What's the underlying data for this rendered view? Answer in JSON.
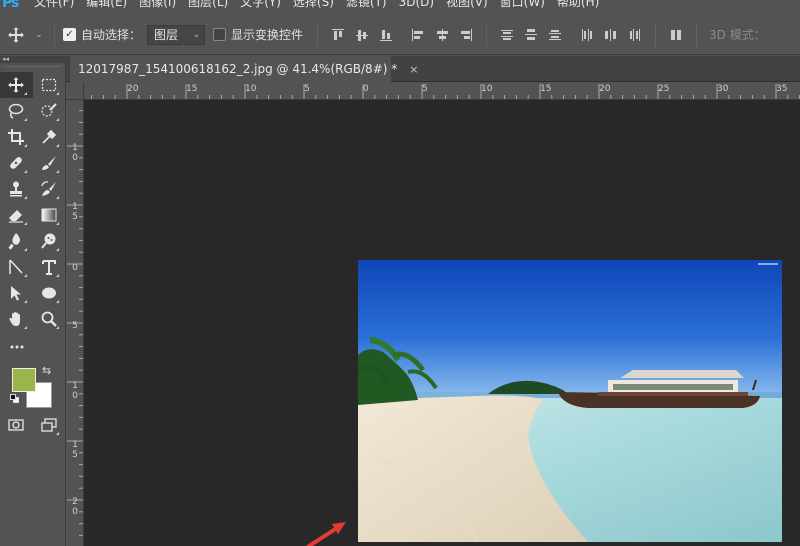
{
  "app": {
    "logo": "Ps"
  },
  "menu": [
    "文件(F)",
    "编辑(E)",
    "图像(I)",
    "图层(L)",
    "文字(Y)",
    "选择(S)",
    "滤镜(T)",
    "3D(D)",
    "视图(V)",
    "窗口(W)",
    "帮助(H)"
  ],
  "options": {
    "auto_select_label": "自动选择：",
    "auto_select_checked": true,
    "layer_select_value": "图层",
    "show_transform_label": "显示变换控件",
    "mode_3d_label": "3D 模式："
  },
  "document": {
    "tab_title": "12017987_154100618162_2.jpg @ 41.4%(RGB/8#) *",
    "close_glyph": "×"
  },
  "ruler": {
    "h_labels": [
      "20",
      "15",
      "10",
      "5",
      "0",
      "5",
      "10",
      "15",
      "20",
      "25",
      "30",
      "35"
    ],
    "v_labels": [
      "1",
      "0",
      "1",
      "5",
      "0",
      "5",
      "1",
      "0",
      "1",
      "5",
      "2",
      "0"
    ]
  },
  "colors": {
    "foreground": "#9bb54a",
    "background": "#ffffff",
    "annotation_arrow": "#e53a35",
    "accent": "#31a8ff"
  },
  "tools": [
    [
      "move-icon",
      "marquee-icon"
    ],
    [
      "lasso-icon",
      "quick-select-icon"
    ],
    [
      "crop-icon",
      "eyedropper-icon"
    ],
    [
      "healing-icon",
      "brush-icon"
    ],
    [
      "stamp-icon",
      "history-brush-icon"
    ],
    [
      "eraser-icon",
      "gradient-icon"
    ],
    [
      "blur-icon",
      "dodge-icon"
    ],
    [
      "pen-icon",
      "type-icon"
    ],
    [
      "path-select-icon",
      "ellipse-icon"
    ],
    [
      "hand-icon",
      "zoom-icon"
    ],
    [
      "more-tools-icon"
    ]
  ]
}
